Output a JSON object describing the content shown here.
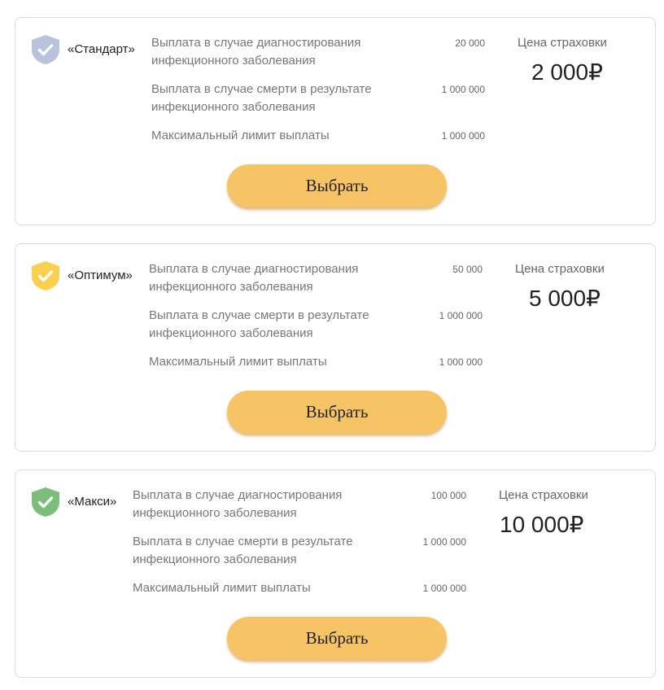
{
  "plans": [
    {
      "name": "«Стандарт»",
      "shield_color": "#b9c3dd",
      "features": [
        {
          "label": "Выплата в случае диагностирования инфекционного заболевания",
          "value": "20 000"
        },
        {
          "label": "Выплата в случае смерти в результате инфекционного заболевания",
          "value": "1 000 000"
        },
        {
          "label": "Максимальный лимит выплаты",
          "value": "1 000 000"
        }
      ],
      "price_label": "Цена страховки",
      "price": "2 000₽",
      "button_label": "Выбрать"
    },
    {
      "name": "«Оптимум»",
      "shield_color": "#fbd04e",
      "features": [
        {
          "label": "Выплата в случае диагностирования инфекционного заболевания",
          "value": "50 000"
        },
        {
          "label": "Выплата в случае смерти в результате инфекционного заболевания",
          "value": "1 000 000"
        },
        {
          "label": "Максимальный лимит выплаты",
          "value": "1 000 000"
        }
      ],
      "price_label": "Цена страховки",
      "price": "5 000₽",
      "button_label": "Выбрать"
    },
    {
      "name": "«Макси»",
      "shield_color": "#7dbd7b",
      "features": [
        {
          "label": "Выплата в случае диагностирования инфекционного заболевания",
          "value": "100 000"
        },
        {
          "label": "Выплата в случае смерти в результате инфекционного заболевания",
          "value": "1 000 000"
        },
        {
          "label": "Максимальный лимит выплаты",
          "value": "1 000 000"
        }
      ],
      "price_label": "Цена страховки",
      "price": "10 000₽",
      "button_label": "Выбрать"
    }
  ],
  "icons": {
    "plan_badge": "shield-check-icon"
  },
  "colors": {
    "button": "#f6c464",
    "card_border": "#dcdcdc"
  }
}
